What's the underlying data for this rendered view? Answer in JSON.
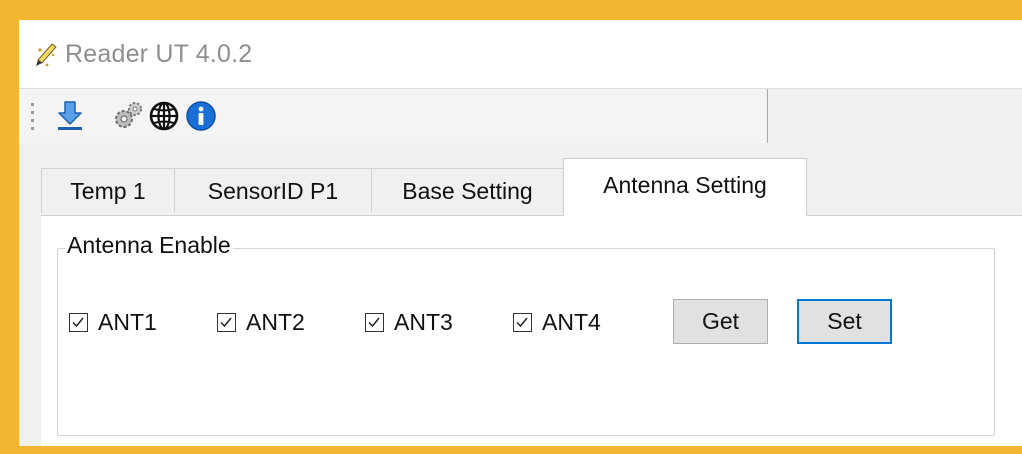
{
  "window": {
    "title": "Reader UT 4.0.2",
    "app_icon": "pen-icon"
  },
  "toolbar": {
    "buttons": [
      {
        "icon": "download-icon"
      },
      {
        "icon": "gears-icon"
      },
      {
        "icon": "globe-icon"
      },
      {
        "icon": "info-icon"
      }
    ]
  },
  "tabs": [
    {
      "label": "Temp 1",
      "active": false
    },
    {
      "label": "SensorID P1",
      "active": false
    },
    {
      "label": "Base Setting",
      "active": false
    },
    {
      "label": "Antenna Setting",
      "active": true
    }
  ],
  "antenna_group": {
    "legend": "Antenna Enable",
    "checkboxes": [
      {
        "label": "ANT1",
        "checked": true
      },
      {
        "label": "ANT2",
        "checked": true
      },
      {
        "label": "ANT3",
        "checked": true
      },
      {
        "label": "ANT4",
        "checked": true
      }
    ],
    "get_label": "Get",
    "set_label": "Set"
  },
  "colors": {
    "frame": "#f2b631",
    "focus_border": "#0078d7",
    "info_blue": "#1a6fd6"
  }
}
